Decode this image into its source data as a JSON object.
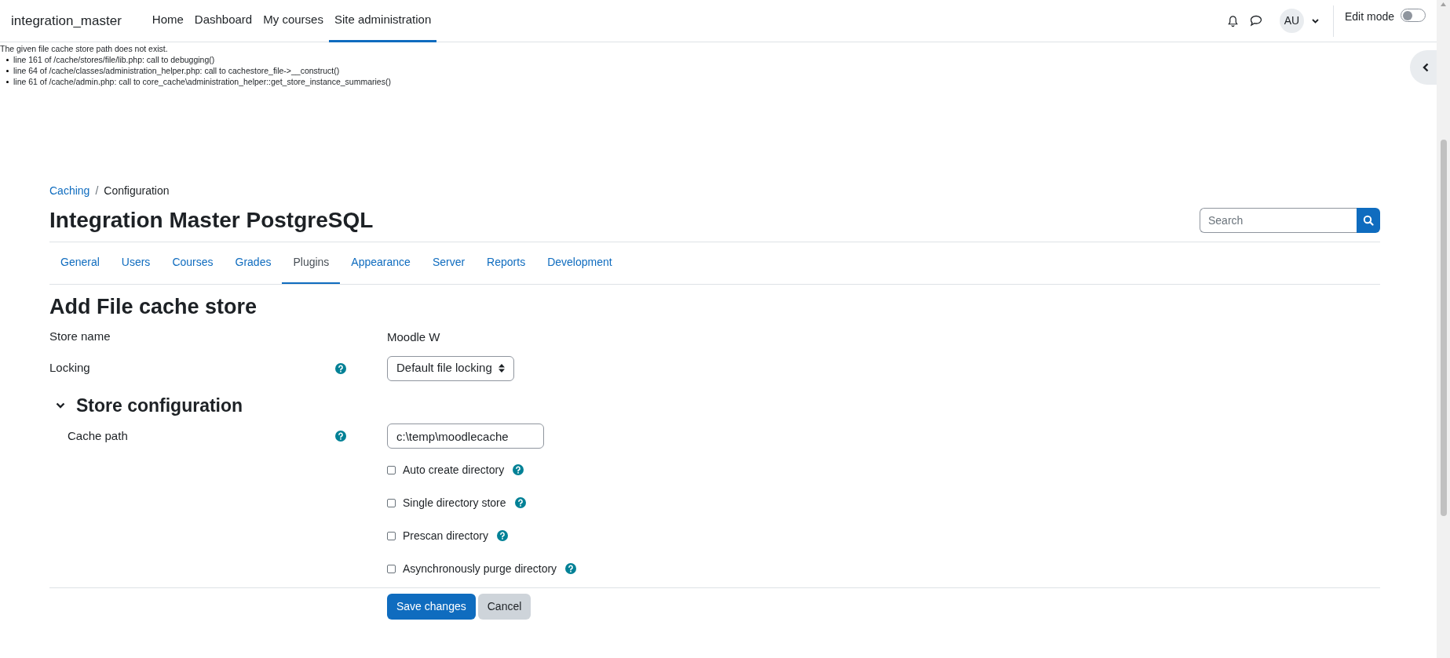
{
  "navbar": {
    "brand": "integration_master",
    "items": [
      {
        "label": "Home",
        "selected": false
      },
      {
        "label": "Dashboard",
        "selected": false
      },
      {
        "label": "My courses",
        "selected": false
      },
      {
        "label": "Site administration",
        "selected": true
      }
    ],
    "avatar": "AU",
    "edit_mode": {
      "label": "Edit mode",
      "on": false
    }
  },
  "debug": {
    "message": "The given file cache store path does not exist.",
    "trace": [
      "line 161 of /cache/stores/file/lib.php: call to debugging()",
      "line 64 of /cache/classes/administration_helper.php: call to cachestore_file->__construct()",
      "line 61 of /cache/admin.php: call to core_cache\\administration_helper::get_store_instance_summaries()"
    ]
  },
  "breadcrumb": {
    "separator": "/",
    "items": [
      {
        "label": "Caching",
        "link": true
      },
      {
        "label": "Configuration",
        "link": false
      }
    ]
  },
  "page_title": "Integration Master PostgreSQL",
  "search": {
    "placeholder": "Search"
  },
  "tabs": [
    {
      "label": "General",
      "selected": false
    },
    {
      "label": "Users",
      "selected": false
    },
    {
      "label": "Courses",
      "selected": false
    },
    {
      "label": "Grades",
      "selected": false
    },
    {
      "label": "Plugins",
      "selected": true
    },
    {
      "label": "Appearance",
      "selected": false
    },
    {
      "label": "Server",
      "selected": false
    },
    {
      "label": "Reports",
      "selected": false
    },
    {
      "label": "Development",
      "selected": false
    }
  ],
  "form": {
    "title": "Add File cache store",
    "fields": [
      {
        "kind": "static",
        "label": "Store name",
        "value": "Moodle W",
        "help": false
      },
      {
        "kind": "select",
        "label": "Locking",
        "value": "Default file locking",
        "help": true
      }
    ],
    "section": {
      "title": "Store configuration",
      "expanded": true,
      "fields": [
        {
          "kind": "text",
          "label": "Cache path",
          "value": "c:\\temp\\moodlecache",
          "help": true
        }
      ],
      "checkboxes": [
        {
          "label": "Auto create directory",
          "checked": false
        },
        {
          "label": "Single directory store",
          "checked": false
        },
        {
          "label": "Prescan directory",
          "checked": false
        },
        {
          "label": "Asynchronously purge directory",
          "checked": false
        }
      ]
    },
    "buttons": [
      {
        "label": "Save changes",
        "kind": "primary"
      },
      {
        "label": "Cancel",
        "kind": "secondary"
      }
    ]
  }
}
